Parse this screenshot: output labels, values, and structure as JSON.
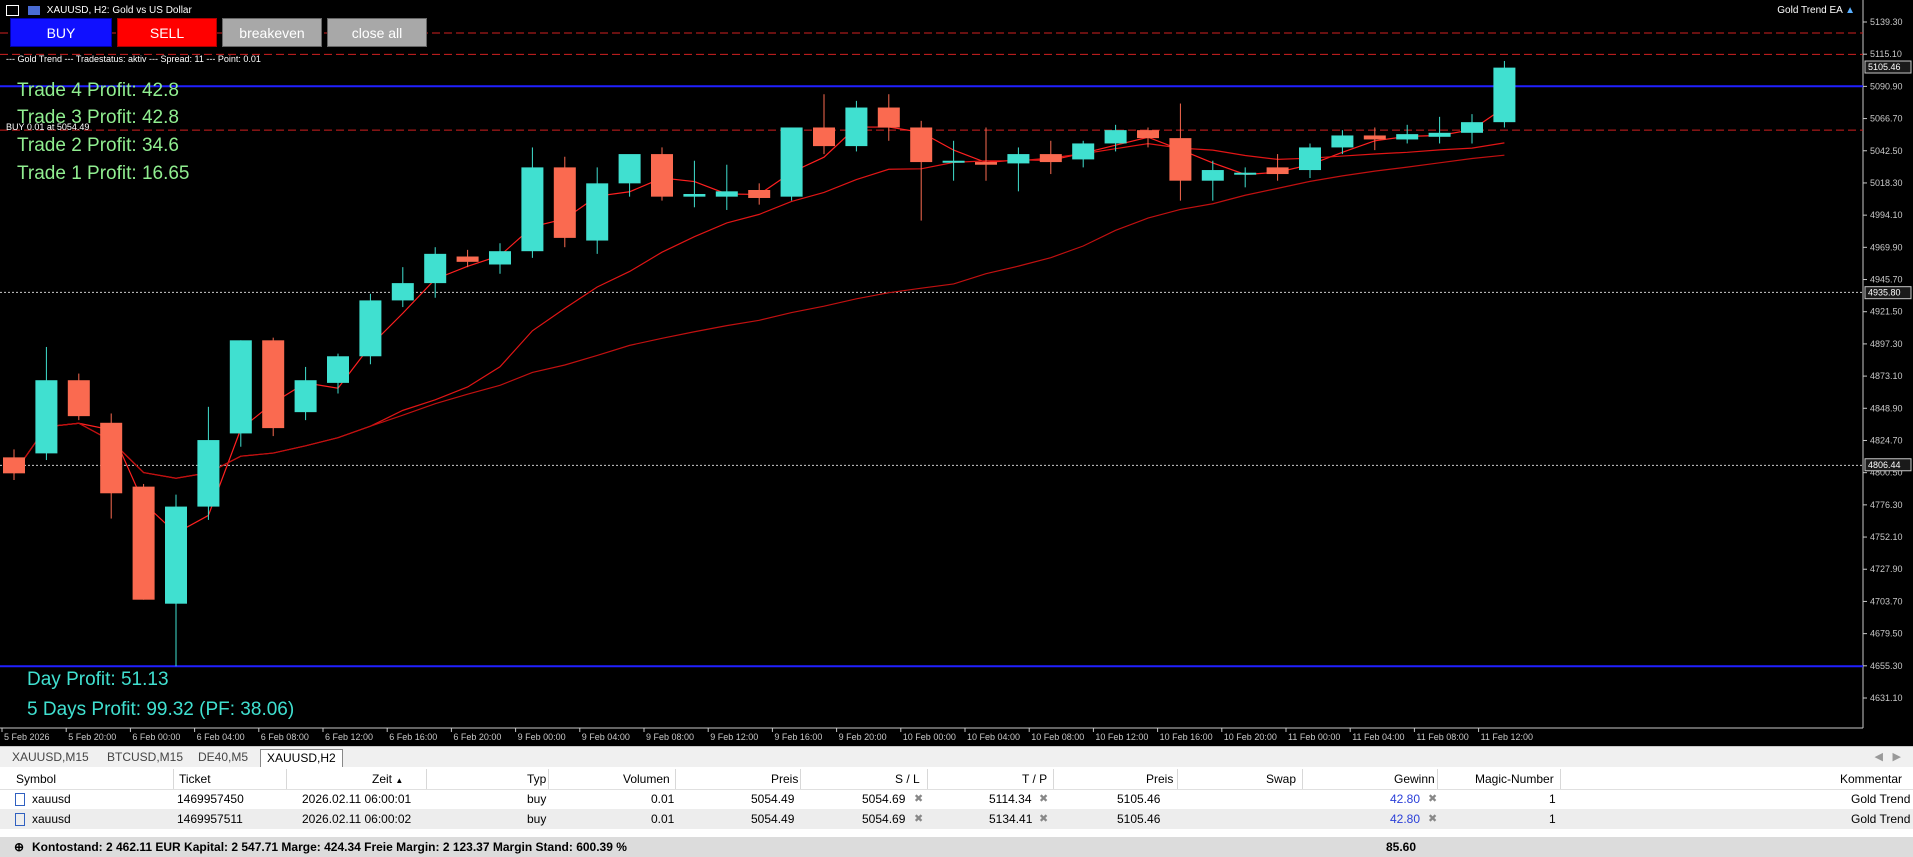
{
  "window": {
    "title": "XAUUSD, H2:  Gold vs US Dollar",
    "ea_name": "Gold Trend EA"
  },
  "buttons": {
    "buy": "BUY",
    "sell": "SELL",
    "breakeven": "breakeven",
    "close_all": "close all"
  },
  "status_line": "--- Gold Trend --- Tradestatus: aktiv --- Spread: 11 --- Point: 0.01",
  "buy_line_label": "BUY 0.01 at 5054.49",
  "trades": [
    "Trade 4 Profit: 42.8",
    "Trade 3 Profit: 42.8",
    "Trade 2 Profit: 34.6",
    "Trade 1 Profit: 16.65"
  ],
  "day_profit": "Day Profit: 51.13",
  "five_days_profit": "5 Days Profit: 99.32 (PF: 38.06)",
  "price_axis": [
    "5139.30",
    "5115.10",
    "5090.90",
    "5066.70",
    "5042.50",
    "5018.30",
    "4994.10",
    "4969.90",
    "4945.70",
    "4921.50",
    "4897.30",
    "4873.10",
    "4848.90",
    "4824.70",
    "4800.50",
    "4776.30",
    "4752.10",
    "4727.90",
    "4703.70",
    "4679.50",
    "4655.30",
    "4631.10"
  ],
  "price_tags": {
    "current": "5105.46",
    "line_mid": "4935.80",
    "line_low": "4806.44"
  },
  "time_axis": [
    "5 Feb 2026",
    "5 Feb 20:00",
    "6 Feb 00:00",
    "6 Feb 04:00",
    "6 Feb 08:00",
    "6 Feb 12:00",
    "6 Feb 16:00",
    "6 Feb 20:00",
    "9 Feb 00:00",
    "9 Feb 04:00",
    "9 Feb 08:00",
    "9 Feb 12:00",
    "9 Feb 16:00",
    "9 Feb 20:00",
    "10 Feb 00:00",
    "10 Feb 04:00",
    "10 Feb 08:00",
    "10 Feb 12:00",
    "10 Feb 16:00",
    "10 Feb 20:00",
    "11 Feb 00:00",
    "11 Feb 04:00",
    "11 Feb 08:00",
    "11 Feb 12:00"
  ],
  "tabs": [
    "XAUUSD,M15",
    "BTCUSD,M15",
    "DE40,M5",
    "XAUUSD,H2"
  ],
  "table": {
    "headers": {
      "symbol": "Symbol",
      "ticket": "Ticket",
      "zeit": "Zeit",
      "typ": "Typ",
      "volumen": "Volumen",
      "preis": "Preis",
      "sl": "S / L",
      "tp": "T / P",
      "preis2": "Preis",
      "swap": "Swap",
      "gewinn": "Gewinn",
      "magic": "Magic-Number",
      "kommentar": "Kommentar"
    },
    "rows": [
      {
        "symbol": "xauusd",
        "ticket": "1469957450",
        "zeit": "2026.02.11 06:00:01",
        "typ": "buy",
        "volumen": "0.01",
        "preis": "5054.49",
        "sl": "5054.69",
        "tp": "5114.34",
        "preis2": "5105.46",
        "swap": "",
        "gewinn": "42.80",
        "magic": "1",
        "kommentar": "Gold Trend"
      },
      {
        "symbol": "xauusd",
        "ticket": "1469957511",
        "zeit": "2026.02.11 06:00:02",
        "typ": "buy",
        "volumen": "0.01",
        "preis": "5054.49",
        "sl": "5054.69",
        "tp": "5134.41",
        "preis2": "5105.46",
        "swap": "",
        "gewinn": "42.80",
        "magic": "1",
        "kommentar": "Gold Trend"
      }
    ],
    "footer_text": "Kontostand: 2 462.11 EUR  Kapital: 2 547.71  Marge: 424.34  Freie Margin: 2 123.37  Margin Stand: 600.39 %",
    "footer_total": "85.60"
  },
  "chart_data": {
    "type": "candlestick",
    "title": "XAUUSD, H2:  Gold vs US Dollar",
    "ylim": [
      4620,
      5155
    ],
    "bull_color": "#40e0d0",
    "bear_color": "#fa6a50",
    "candles": [
      {
        "o": 4812,
        "h": 4818,
        "c": 4800,
        "l": 4795
      },
      {
        "o": 4815,
        "h": 4895,
        "c": 4870,
        "l": 4810
      },
      {
        "o": 4870,
        "h": 4875,
        "c": 4843,
        "l": 4840
      },
      {
        "o": 4838,
        "h": 4845,
        "c": 4785,
        "l": 4766
      },
      {
        "o": 4790,
        "h": 4792,
        "c": 4705,
        "l": 4705
      },
      {
        "o": 4702,
        "h": 4784,
        "c": 4775,
        "l": 4655
      },
      {
        "o": 4775,
        "h": 4850,
        "c": 4825,
        "l": 4765
      },
      {
        "o": 4830,
        "h": 4900,
        "c": 4900,
        "l": 4820
      },
      {
        "o": 4900,
        "h": 4902,
        "c": 4834,
        "l": 4828
      },
      {
        "o": 4846,
        "h": 4880,
        "c": 4870,
        "l": 4840
      },
      {
        "o": 4868,
        "h": 4890,
        "c": 4888,
        "l": 4860
      },
      {
        "o": 4888,
        "h": 4935,
        "c": 4930,
        "l": 4882
      },
      {
        "o": 4930,
        "h": 4955,
        "c": 4943,
        "l": 4925
      },
      {
        "o": 4943,
        "h": 4970,
        "c": 4965,
        "l": 4932
      },
      {
        "o": 4963,
        "h": 4968,
        "c": 4959,
        "l": 4955
      },
      {
        "o": 4957,
        "h": 4973,
        "c": 4967,
        "l": 4950
      },
      {
        "o": 4967,
        "h": 5045,
        "c": 5030,
        "l": 4962
      },
      {
        "o": 5030,
        "h": 5038,
        "c": 4977,
        "l": 4970
      },
      {
        "o": 4975,
        "h": 5030,
        "c": 5018,
        "l": 4965
      },
      {
        "o": 5018,
        "h": 5038,
        "c": 5040,
        "l": 5008
      },
      {
        "o": 5040,
        "h": 5045,
        "c": 5008,
        "l": 5005
      },
      {
        "o": 5008,
        "h": 5035,
        "c": 5010,
        "l": 5000
      },
      {
        "o": 5008,
        "h": 5032,
        "c": 5012,
        "l": 4998
      },
      {
        "o": 5013,
        "h": 5018,
        "c": 5007,
        "l": 5002
      },
      {
        "o": 5008,
        "h": 5060,
        "c": 5060,
        "l": 5005
      },
      {
        "o": 5060,
        "h": 5085,
        "c": 5046,
        "l": 5040
      },
      {
        "o": 5046,
        "h": 5080,
        "c": 5075,
        "l": 5042
      },
      {
        "o": 5075,
        "h": 5085,
        "c": 5060,
        "l": 5050
      },
      {
        "o": 5060,
        "h": 5065,
        "c": 5034,
        "l": 4990
      },
      {
        "o": 5034,
        "h": 5050,
        "c": 5035,
        "l": 5020
      },
      {
        "o": 5034,
        "h": 5060,
        "c": 5032,
        "l": 5020
      },
      {
        "o": 5033,
        "h": 5045,
        "c": 5040,
        "l": 5012
      },
      {
        "o": 5040,
        "h": 5050,
        "c": 5034,
        "l": 5025
      },
      {
        "o": 5036,
        "h": 5050,
        "c": 5048,
        "l": 5030
      },
      {
        "o": 5048,
        "h": 5062,
        "c": 5058,
        "l": 5042
      },
      {
        "o": 5058,
        "h": 5060,
        "c": 5052,
        "l": 5045
      },
      {
        "o": 5052,
        "h": 5078,
        "c": 5020,
        "l": 5005
      },
      {
        "o": 5020,
        "h": 5035,
        "c": 5028,
        "l": 5005
      },
      {
        "o": 5025,
        "h": 5030,
        "c": 5026,
        "l": 5015
      },
      {
        "o": 5030,
        "h": 5040,
        "c": 5025,
        "l": 5020
      },
      {
        "o": 5028,
        "h": 5048,
        "c": 5045,
        "l": 5022
      },
      {
        "o": 5045,
        "h": 5058,
        "c": 5054,
        "l": 5040
      },
      {
        "o": 5054,
        "h": 5060,
        "c": 5051,
        "l": 5043
      },
      {
        "o": 5051,
        "h": 5062,
        "c": 5055,
        "l": 5048
      },
      {
        "o": 5053,
        "h": 5068,
        "c": 5056,
        "l": 5048
      },
      {
        "o": 5056,
        "h": 5070,
        "c": 5064,
        "l": 5048
      },
      {
        "o": 5064,
        "h": 5110,
        "c": 5105,
        "l": 5060
      }
    ],
    "hlines": [
      {
        "price": 5131,
        "color": "#d02020",
        "style": "dash"
      },
      {
        "price": 5115,
        "color": "#d02020",
        "style": "dash"
      },
      {
        "price": 5091,
        "color": "#2020ff",
        "style": "solid"
      },
      {
        "price": 5058,
        "color": "#d02020",
        "style": "dash"
      },
      {
        "price": 4936,
        "color": "#cccccc",
        "style": "dot"
      },
      {
        "price": 4806,
        "color": "#cccccc",
        "style": "dot"
      },
      {
        "price": 4655,
        "color": "#2020ff",
        "style": "solid"
      }
    ]
  }
}
